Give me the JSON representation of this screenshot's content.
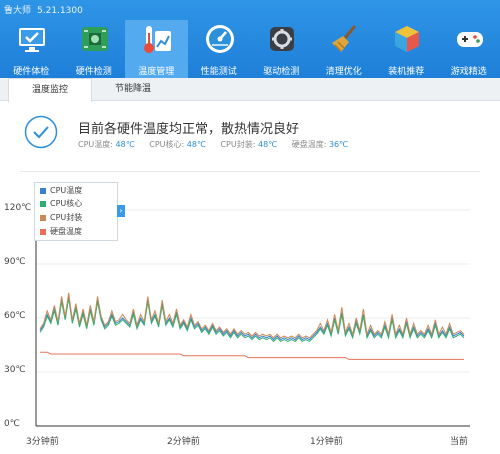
{
  "app": {
    "title": "鲁大师",
    "version": "5.21.1300"
  },
  "nav": [
    {
      "label": "硬件体检",
      "icon": "monitor-check-icon"
    },
    {
      "label": "硬件检测",
      "icon": "circuit-board-icon"
    },
    {
      "label": "温度管理",
      "icon": "thermometer-icon"
    },
    {
      "label": "性能测试",
      "icon": "speedometer-icon"
    },
    {
      "label": "驱动检测",
      "icon": "driver-gear-icon"
    },
    {
      "label": "清理优化",
      "icon": "broom-icon"
    },
    {
      "label": "装机推荐",
      "icon": "cube-icon"
    },
    {
      "label": "游戏精选",
      "icon": "gamepad-icon"
    }
  ],
  "tabs": [
    "温度监控",
    "节能降温"
  ],
  "status": {
    "title": "目前各硬件温度均正常，散热情况良好",
    "items": [
      {
        "label": "CPU温度:",
        "value": "48℃"
      },
      {
        "label": "CPU核心:",
        "value": "48℃"
      },
      {
        "label": "CPU封装:",
        "value": "48℃"
      },
      {
        "label": "硬盘温度:",
        "value": "36℃"
      }
    ]
  },
  "colors": {
    "cpu_temp": "#3d7fcf",
    "cpu_core": "#2fae72",
    "cpu_package": "#c98a55",
    "disk": "#e8705a",
    "accent": "#2c90db"
  },
  "chart_data": {
    "type": "line",
    "x": [
      "3分钟前",
      "2分钟前",
      "1分钟前",
      "当前"
    ],
    "yticks": [
      "0℃",
      "30℃",
      "60℃",
      "90℃",
      "120℃"
    ],
    "ylim": [
      0,
      130
    ],
    "legend": "top-left",
    "series": [
      {
        "name": "CPU温度",
        "color": "#3d7fcf",
        "values": [
          53,
          56,
          62,
          58,
          65,
          57,
          70,
          60,
          72,
          58,
          66,
          56,
          63,
          55,
          65,
          57,
          70,
          60,
          55,
          57,
          62,
          57,
          58,
          60,
          58,
          56,
          63,
          55,
          60,
          57,
          70,
          58,
          62,
          56,
          68,
          57,
          60,
          56,
          63,
          55,
          58,
          54,
          60,
          55,
          57,
          53,
          55,
          52,
          56,
          52,
          54,
          51,
          53,
          50,
          53,
          50,
          52,
          50,
          51,
          49,
          51,
          49,
          50,
          49,
          50,
          48,
          50,
          48,
          49,
          48,
          49,
          48,
          50,
          48,
          49,
          48,
          50,
          52,
          55,
          52,
          57,
          51,
          60,
          52,
          63,
          51,
          55,
          50,
          58,
          52,
          62,
          50,
          54,
          50,
          52,
          50,
          56,
          50,
          60,
          50,
          54,
          50,
          58,
          50,
          55,
          50,
          52,
          50,
          54,
          50,
          57,
          50,
          53,
          50,
          55,
          50,
          51,
          52,
          50
        ]
      },
      {
        "name": "CPU核心",
        "color": "#2fae72",
        "values": [
          52,
          55,
          61,
          57,
          64,
          56,
          69,
          59,
          71,
          57,
          65,
          55,
          62,
          54,
          64,
          56,
          69,
          59,
          54,
          56,
          61,
          56,
          57,
          59,
          57,
          55,
          62,
          54,
          59,
          56,
          69,
          57,
          61,
          55,
          67,
          56,
          59,
          55,
          62,
          54,
          57,
          53,
          59,
          54,
          56,
          52,
          54,
          51,
          55,
          51,
          53,
          50,
          52,
          49,
          52,
          49,
          51,
          49,
          50,
          48,
          50,
          48,
          49,
          48,
          49,
          47,
          49,
          47,
          48,
          47,
          48,
          47,
          49,
          47,
          48,
          47,
          49,
          51,
          54,
          51,
          56,
          50,
          59,
          51,
          62,
          50,
          54,
          49,
          57,
          51,
          61,
          49,
          53,
          49,
          51,
          49,
          55,
          49,
          59,
          49,
          53,
          49,
          57,
          49,
          54,
          49,
          51,
          49,
          53,
          49,
          56,
          49,
          52,
          49,
          54,
          49,
          50,
          51,
          49
        ]
      },
      {
        "name": "CPU封装",
        "color": "#c98a55",
        "values": [
          54,
          57,
          64,
          59,
          67,
          58,
          72,
          61,
          74,
          59,
          68,
          57,
          65,
          56,
          67,
          58,
          72,
          61,
          56,
          58,
          64,
          58,
          59,
          62,
          59,
          57,
          65,
          56,
          62,
          58,
          72,
          59,
          64,
          57,
          70,
          58,
          62,
          57,
          65,
          56,
          59,
          55,
          62,
          56,
          58,
          54,
          56,
          53,
          57,
          53,
          55,
          52,
          54,
          51,
          54,
          51,
          53,
          51,
          52,
          50,
          52,
          50,
          51,
          50,
          51,
          49,
          51,
          49,
          50,
          49,
          50,
          49,
          51,
          49,
          50,
          49,
          51,
          53,
          57,
          53,
          59,
          52,
          62,
          53,
          66,
          52,
          57,
          51,
          60,
          53,
          65,
          51,
          56,
          51,
          53,
          51,
          58,
          51,
          62,
          51,
          56,
          51,
          60,
          51,
          57,
          51,
          53,
          51,
          56,
          51,
          59,
          51,
          55,
          51,
          57,
          51,
          52,
          53,
          51
        ]
      },
      {
        "name": "硬盘温度",
        "color": "#e8705a",
        "values": [
          41,
          41,
          41,
          40,
          40,
          40,
          40,
          40,
          40,
          40,
          40,
          40,
          40,
          40,
          40,
          40,
          40,
          40,
          40,
          40,
          40,
          40,
          40,
          40,
          40,
          40,
          40,
          40,
          40,
          40,
          40,
          40,
          40,
          40,
          40,
          40,
          40,
          40,
          40,
          40,
          39,
          39,
          39,
          39,
          39,
          39,
          39,
          39,
          39,
          39,
          39,
          39,
          39,
          39,
          39,
          39,
          39,
          39,
          38,
          38,
          38,
          38,
          38,
          38,
          38,
          38,
          38,
          38,
          38,
          38,
          38,
          38,
          38,
          38,
          38,
          38,
          38,
          38,
          38,
          38,
          38,
          38,
          38,
          38,
          38,
          38,
          37,
          37,
          37,
          37,
          37,
          37,
          37,
          37,
          37,
          37,
          37,
          37,
          37,
          37,
          37,
          37,
          37,
          37,
          37,
          37,
          37,
          37,
          37,
          37,
          37,
          37,
          37,
          37,
          37,
          37,
          37,
          37,
          37
        ]
      }
    ]
  }
}
